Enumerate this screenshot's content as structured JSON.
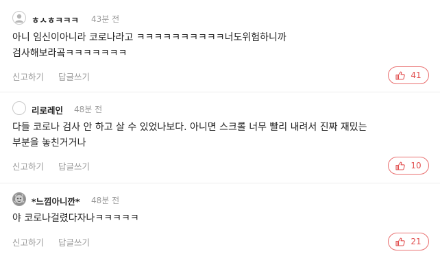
{
  "comments": [
    {
      "nickname": "ㅎㅅㅎㅋㅋㅋ",
      "time": "43분 전",
      "text": "아니 임신이아니라 코로나라고 ㅋㅋㅋㅋㅋㅋㅋㅋㅋㅋ너도위험하니까\n검사해보라곸ㅋㅋㅋㅋㅋㅋㅋ",
      "report_label": "신고하기",
      "reply_label": "답글쓰기",
      "likes": "41",
      "avatar_icon": "default-user-icon"
    },
    {
      "nickname": "리로레인",
      "time": "48분 전",
      "text": "다들 코로나 검사 안 하고 살 수 있었나보다. 아니면 스크롤 너무 빨리 내려서 진짜 재밌는\n부분을 놓친거거나",
      "report_label": "신고하기",
      "reply_label": "답글쓰기",
      "likes": "10",
      "avatar_icon": "blank-avatar"
    },
    {
      "nickname": "*느낌아니깐*",
      "time": "48분 전",
      "text": "야 코로나걸렸다자나ㅋㅋㅋㅋㅋ",
      "report_label": "신고하기",
      "reply_label": "답글쓰기",
      "likes": "21",
      "avatar_icon": "photo-avatar"
    }
  ],
  "colors": {
    "like_accent": "#e14f4f",
    "muted_text": "#999999",
    "divider": "#ececec"
  }
}
